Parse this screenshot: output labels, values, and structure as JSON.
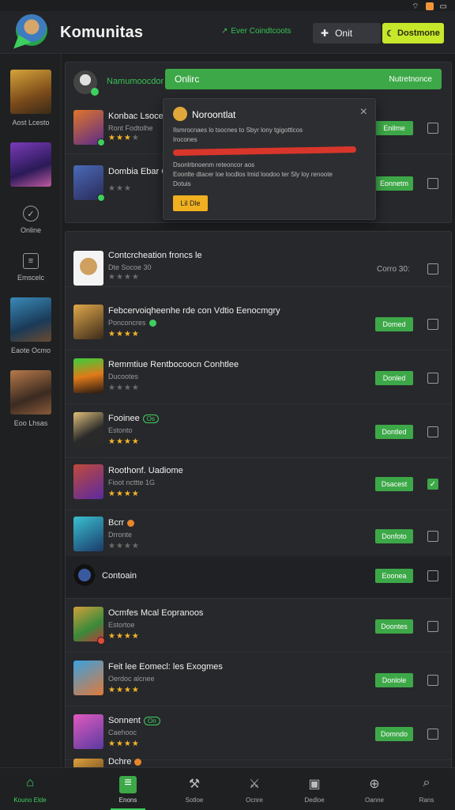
{
  "status": {
    "wifi": "wifi-icon",
    "battery": "battery-icon"
  },
  "header": {
    "title": "Komunitas",
    "link_label": "Ever Coindtcoots",
    "online_label": "Onit",
    "cta_label": "Dostmone"
  },
  "sidebar": {
    "items": [
      {
        "label": "Aost Lcesto",
        "kind": "thumb"
      },
      {
        "label": "",
        "kind": "thumb"
      },
      {
        "label": "Online",
        "kind": "icon",
        "icon": "compass-icon"
      },
      {
        "label": "Emscelc",
        "kind": "icon",
        "icon": "menu-icon"
      },
      {
        "label": "Eaote Ocmo",
        "kind": "thumb"
      },
      {
        "label": "Eoo Lhsas",
        "kind": "thumb"
      }
    ]
  },
  "top_card": {
    "user_name": "Namumoocdor",
    "online_label": "Onlirc",
    "online_right": "Nutretnonce",
    "rows": [
      {
        "name": "Konbac Lsoceth",
        "sub": "Ront Fodtolhe",
        "btn": "Enilme"
      },
      {
        "name": "Dombia Ebar G",
        "sub": "",
        "btn": "Eonnetm"
      }
    ]
  },
  "popup": {
    "title": "Noroontlat",
    "line1": "Ilsmrocnaes lo tsocnes to Sbyr lony tgigottlcos",
    "line2": "Irocones",
    "line3": "Dsonlrbnoenm reteoncor aos",
    "line4": "Eoonlte dtacer loe locdlos Imid loodoo ter Sly loy renoote",
    "line5": "Dotuis",
    "button": "Lil Dle"
  },
  "list": {
    "rows": [
      {
        "name": "Contcrcheation froncs le",
        "sub": "Dte  Socoe 30",
        "plain": "Corro 30:",
        "checked": false
      },
      {
        "name": "Febcervoiqheenhe rde con Vdtio Eenocmgry",
        "sub": "Ponconcres",
        "btn": "Domed",
        "checked": false
      },
      {
        "name": "Remmtiue Rentbocoocn Conhtlee",
        "sub": "Ducootes",
        "btn": "Donled",
        "checked": false
      },
      {
        "name": "Fooinee",
        "pill": "Os",
        "sub": "Estonto",
        "btn": "Dontled",
        "checked": false
      },
      {
        "name": "Roothonf. Uadiome",
        "sub": "Fioot ncttte 1G",
        "btn": "Dsacest",
        "checked": true
      },
      {
        "name": "Bcrr",
        "sub": "Drronte",
        "btn": "Donfoto",
        "checked": false
      },
      {
        "name": "Contoain",
        "sub": "",
        "btn": "Eoonea",
        "checked": false
      },
      {
        "name": "Ocmfes  Mcal Eopranoos",
        "sub": "Estortoe",
        "btn": "Doontes",
        "checked": false
      },
      {
        "name": "Feit lee Eomecl: les Exogmes",
        "sub": "Oerdoc  alcnee",
        "btn": "Donlole",
        "checked": false
      },
      {
        "name": "Sonnent",
        "pill": "On",
        "sub": "Caehooc",
        "btn": "Domndo",
        "checked": false
      },
      {
        "name": "Dchre",
        "sub": "",
        "btn": "",
        "checked": false
      }
    ]
  },
  "bottom_nav": [
    {
      "label": "Kouno Elde",
      "icon": "home-icon"
    },
    {
      "label": "Enons",
      "icon": "list-icon"
    },
    {
      "label": "Sotloe",
      "icon": "tools-icon"
    },
    {
      "label": "Ocnre",
      "icon": "sword-icon"
    },
    {
      "label": "Dedloe",
      "icon": "gamepad-icon"
    },
    {
      "label": "Oanne",
      "icon": "controller-icon"
    },
    {
      "label": "Rans",
      "icon": "search-icon"
    }
  ],
  "colors": {
    "accent": "#3da848",
    "bg": "#1d1e20",
    "star": "#f4b428",
    "cta": "#c6e82a"
  }
}
